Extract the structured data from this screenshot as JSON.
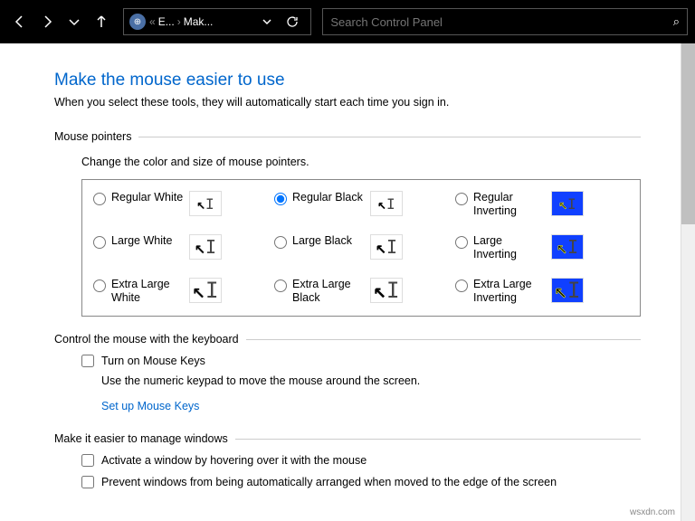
{
  "toolbar": {
    "breadcrumb": {
      "part1": "E...",
      "part2": "Mak..."
    },
    "search_placeholder": "Search Control Panel"
  },
  "page": {
    "title": "Make the mouse easier to use",
    "subtitle": "When you select these tools, they will automatically start each time you sign in."
  },
  "pointers": {
    "legend": "Mouse pointers",
    "desc": "Change the color and size of mouse pointers.",
    "options": [
      {
        "label": "Regular White",
        "scheme": "white",
        "size": "r",
        "selected": false
      },
      {
        "label": "Regular Black",
        "scheme": "black",
        "size": "r",
        "selected": true
      },
      {
        "label": "Regular Inverting",
        "scheme": "inv",
        "size": "r",
        "selected": false
      },
      {
        "label": "Large White",
        "scheme": "white",
        "size": "l",
        "selected": false
      },
      {
        "label": "Large Black",
        "scheme": "black",
        "size": "l",
        "selected": false
      },
      {
        "label": "Large Inverting",
        "scheme": "inv",
        "size": "l",
        "selected": false
      },
      {
        "label": "Extra Large White",
        "scheme": "white",
        "size": "xl",
        "selected": false
      },
      {
        "label": "Extra Large Black",
        "scheme": "black",
        "size": "xl",
        "selected": false
      },
      {
        "label": "Extra Large Inverting",
        "scheme": "inv",
        "size": "xl",
        "selected": false
      }
    ]
  },
  "keyboard": {
    "legend": "Control the mouse with the keyboard",
    "mousekeys_label": "Turn on Mouse Keys",
    "mousekeys_checked": false,
    "mousekeys_desc": "Use the numeric keypad to move the mouse around the screen.",
    "setup_link": "Set up Mouse Keys"
  },
  "windows": {
    "legend": "Make it easier to manage windows",
    "hover_label": "Activate a window by hovering over it with the mouse",
    "hover_checked": false,
    "arrange_label": "Prevent windows from being automatically arranged when moved to the edge of the screen",
    "arrange_checked": false
  },
  "watermark": "wsxdn.com"
}
